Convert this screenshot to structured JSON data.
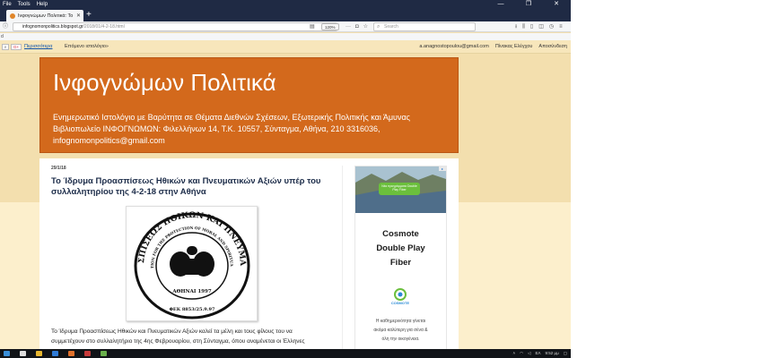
{
  "colors": {
    "page_bg": "#f3dfae",
    "header_bg": "#d3691c",
    "taskbar_bg": "#111418",
    "chrome_dark": "#1f2a44",
    "link": "#1155aa"
  },
  "window": {
    "menu": [
      "File",
      "Tools",
      "Help"
    ],
    "controls": [
      "—",
      "❐",
      "✕"
    ]
  },
  "tab": {
    "title": "Ινφογνώμων Πολιτικά: Το Ίδ..."
  },
  "navbar": {
    "url_host": "infognomonpolitics.blogspot.gr",
    "url_path": "/2018/01/4-2-18.html",
    "zoom": "120%",
    "search_placeholder": "Search"
  },
  "bookmarks": {
    "item": "d"
  },
  "blogger_bar": {
    "g_label": "G+",
    "more": "Περισσότερα",
    "next": "Επόμενο ιστολόγιο»",
    "email": "a.anagnostopoulou@gmail.com",
    "dashboard": "Πίνακας Ελέγχου",
    "logout": "Αποσύνδεση"
  },
  "header": {
    "title": "Ινφογνώμων Πολιτικά",
    "desc_line1": "Ενημερωτικό Ιστολόγιο με Βαρύτητα σε Θέματα Διεθνών Σχέσεων, Εξωτερικής Πολιτικής και Άμυνας",
    "desc_line2": "Βιβλιοπωλείο ΙΝΦΟΓΝΩΜΩΝ: Φιλελλήνων 14, Τ.Κ. 10557, Σύνταγμα, Αθήνα, 210 3316036,",
    "desc_line3": "infognomonpolitics@gmail.com"
  },
  "post": {
    "date": "29/1/18",
    "title": "Το Ίδρυμα Προασπίσεως Ηθικών και Πνευματικών Αξιών υπέρ του συλλαλητηρίου της 4-2-18 στην Αθήνα",
    "seal": {
      "top_text": "ΙΔΡΥΜΑ ΠΡΟΑΣΠΙΣΕΩΣ ΗΘΙΚΩΝ ΚΑΙ ΠΝΕΥΜΑΤΙΚΩΝ ΑΞΙΩΝ",
      "inner_text": "FOUNDATION FOR THE PROTECTION OF MORAL AND SPIRITUAL VALUES",
      "city_year": "ΑΘΗΝΑΙ 1997",
      "fek": "ΦΕΚ 8853/25.9.97"
    },
    "body_line1": "Το Ίδρυμα Προασπίσεως Ηθικών και Πνευματικών Αξιών καλεί τα μέλη και τους φίλους του να",
    "body_line2": "συμμετέχουν στο συλλαλητήριο της 4ης Φεβρουαρίου, στη Σύνταγμα, όπου αναμένεται οι Έλληνες"
  },
  "ad": {
    "banner_text": "Νέα προγράμματα Double Play Fiber",
    "headline_1": "Cosmote",
    "headline_2": "Double Play",
    "headline_3": "Fiber",
    "logo_text": "COSMOTE",
    "body_1": "Η καθημερινότητα γίνεται",
    "body_2": "ακόμα καλύτερη για σένα &",
    "body_3": "όλη την οικογένεια."
  },
  "taskbar": {
    "lang": "ΕΛ",
    "time": "9:52 μμ"
  }
}
